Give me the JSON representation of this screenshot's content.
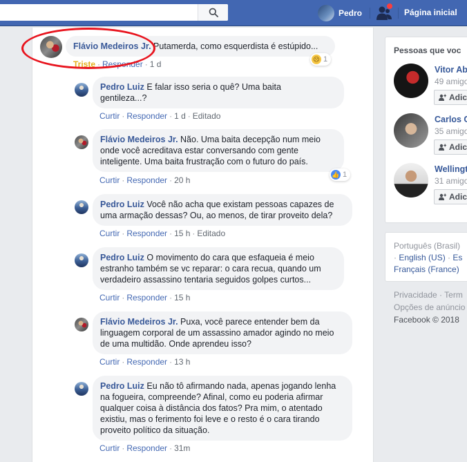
{
  "topbar": {
    "user_name": "Pedro",
    "home_label": "Página inicial"
  },
  "comments": [
    {
      "author": "Flávio Medeiros Jr.",
      "text": "Putamerda, como esquerdista é estúpido...",
      "reaction_label": "Triste",
      "reply": "Responder",
      "time": "1 d",
      "reaction_count": "1"
    },
    {
      "author": "Pedro Luiz",
      "text1": "E falar isso seria o quê? Uma baita",
      "text2": "gentileza...?",
      "like": "Curtir",
      "reply": "Responder",
      "time": "1 d",
      "edited": "Editado"
    },
    {
      "author": "Flávio Medeiros Jr.",
      "text1": "Não. Uma baita decepção num meio",
      "text2": "onde você acreditava estar conversando com gente",
      "text3": "inteligente. Uma baita frustração com o futuro do país.",
      "like": "Curtir",
      "reply": "Responder",
      "time": "20 h",
      "reaction_count": "1"
    },
    {
      "author": "Pedro Luiz",
      "text1": "Você não acha que existam pessoas capazes de",
      "text2": "uma armação dessas? Ou, ao menos, de tirar proveito dela?",
      "like": "Curtir",
      "reply": "Responder",
      "time": "15 h",
      "edited": "Editado"
    },
    {
      "author": "Pedro Luiz",
      "text1": "O movimento do cara que esfaqueia é meio",
      "text2": "estranho também se vc reparar: o cara recua, quando um",
      "text3": "verdadeiro assassino tentaria seguidos golpes curtos...",
      "like": "Curtir",
      "reply": "Responder",
      "time": "15 h"
    },
    {
      "author": "Flávio Medeiros Jr.",
      "text1": "Puxa, você parece entender bem da",
      "text2": "linguagem corporal de um assassino amador agindo no meio",
      "text3": "de uma multidão. Onde aprendeu isso?",
      "like": "Curtir",
      "reply": "Responder",
      "time": "13 h"
    },
    {
      "author": "Pedro Luiz",
      "text1": "Eu não tô afirmando nada, apenas jogando lenha",
      "text2": "na fogueira, compreende? Afinal, como eu poderia afirmar",
      "text3": "qualquer coisa à distância dos fatos? Pra mim, o atentado",
      "text4": "existiu, mas o ferimento foi leve e o resto é o cara tirando",
      "text5": "proveito político da situação.",
      "like": "Curtir",
      "reply": "Responder",
      "time": "31m"
    }
  ],
  "sidebar": {
    "title": "Pessoas que voc",
    "people": [
      {
        "name": "Vitor Ab",
        "sub": "49 amigo",
        "button": "Adic"
      },
      {
        "name": "Carlos C",
        "sub": "35 amigo",
        "button": "Adic"
      },
      {
        "name": "Wellingt",
        "sub": "31 amigo",
        "button": "Adic"
      }
    ],
    "languages": {
      "current": "Português (Brasil)",
      "english": "English (US)",
      "es": "Es",
      "french": "Français (France)"
    },
    "footer": {
      "privacy": "Privacidade",
      "terms": "Term",
      "ads": "Opções de anúncio",
      "copyright": "Facebook © 2018"
    }
  }
}
